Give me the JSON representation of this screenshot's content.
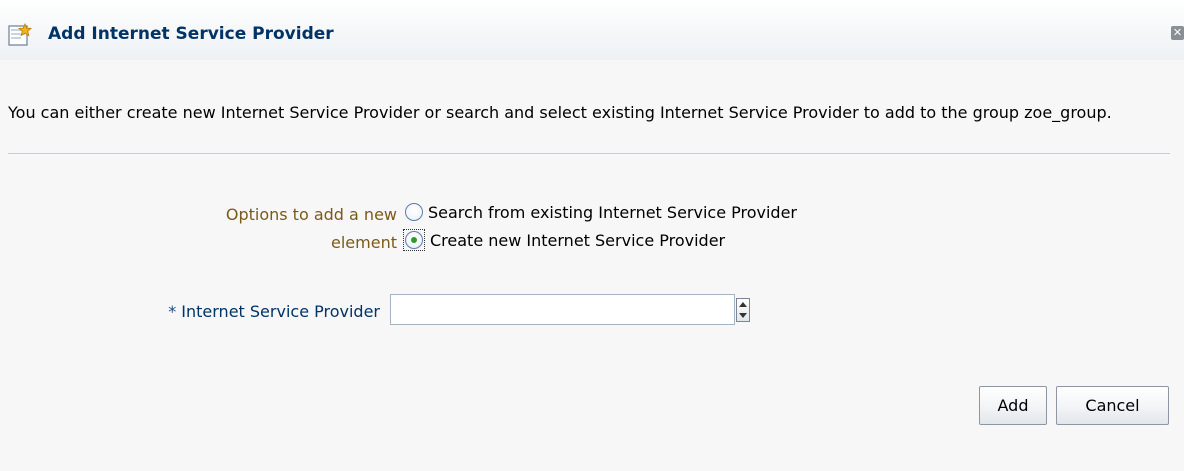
{
  "dialog": {
    "title": "Add Internet Service Provider",
    "title_icon": "add-item-icon",
    "close_icon": "close-icon"
  },
  "description": "You can either create new Internet Service Provider or search and select existing Internet Service Provider to add to the group zoe_group.",
  "options": {
    "label_line1": "Options to add a new",
    "label_line2": "element",
    "choices": [
      {
        "label": "Search from existing Internet Service Provider",
        "selected": false
      },
      {
        "label": "Create new Internet Service Provider",
        "selected": true
      }
    ]
  },
  "field": {
    "required_marker": "*",
    "label": "Internet Service Provider",
    "value": "",
    "stepper_icon": "up-down-stepper-icon"
  },
  "buttons": {
    "add": "Add",
    "cancel": "Cancel"
  },
  "colors": {
    "title": "#003366",
    "option_label": "#7a5a18",
    "field_label": "#003366",
    "selected_dot": "#2f9a2f"
  }
}
